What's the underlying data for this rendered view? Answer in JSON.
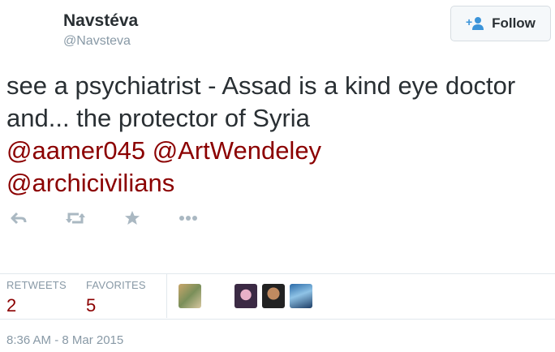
{
  "user": {
    "display_name": "Navstéva",
    "handle": "@Navsteva"
  },
  "follow_label": "Follow",
  "tweet": {
    "text": "see a psychiatrist - Assad is a kind eye doctor and... the protector of Syria",
    "mentions": [
      "@aamer045",
      "@ArtWendeley",
      "@archicivilians"
    ]
  },
  "actions": [
    "reply-icon",
    "retweet-icon",
    "favorite-icon",
    "more-icon"
  ],
  "stats": {
    "retweets_label": "RETWEETS",
    "retweets_value": "2",
    "favorites_label": "FAVORITES",
    "favorites_value": "5"
  },
  "timestamp": "8:36 AM - 8 Mar 2015",
  "colors": {
    "mention": "#8b0000",
    "muted": "#8899a6",
    "text": "#292f33"
  }
}
